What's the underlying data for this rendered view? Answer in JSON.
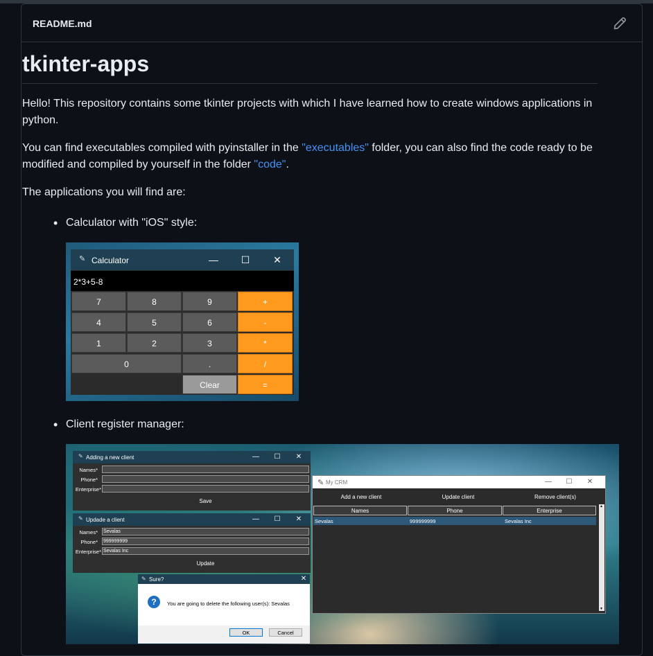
{
  "file": {
    "title": "README.md"
  },
  "readme": {
    "heading": "tkinter-apps",
    "intro": "Hello! This repository contains some tkinter projects with which I have learned how to create windows applications in python.",
    "para2": {
      "text1": "You can find executables compiled with pyinstaller in the ",
      "link1": "\"executables\"",
      "text2": " folder, you can also find the code ready to be modified and compiled by yourself in the folder ",
      "link2": "\"code\"",
      "text3": "."
    },
    "para3": "The applications you will find are:",
    "bullets": [
      "Calculator with \"iOS\" style:",
      "Client register manager:"
    ]
  },
  "calculator": {
    "title": "Calculator",
    "display": "2*3+5-8",
    "controls": {
      "minimize": "—",
      "maximize": "☐",
      "close": "✕"
    },
    "keys": [
      "7",
      "8",
      "9",
      "+",
      "4",
      "5",
      "6",
      "-",
      "1",
      "2",
      "3",
      "*",
      "0",
      ".",
      "/",
      "Clear",
      "="
    ]
  },
  "crm": {
    "add_window": {
      "title": "Adding a new client",
      "labels": [
        "Names*",
        "Phone*",
        "Enterprise*"
      ],
      "values": [
        "",
        "",
        ""
      ],
      "button": "Save"
    },
    "update_window": {
      "title": "Updade a client",
      "labels": [
        "Names*",
        "Phone*",
        "Enterprise*"
      ],
      "values": [
        "Sevalas",
        "999999999",
        "Sevalas Inc"
      ],
      "button": "Update"
    },
    "main_window": {
      "title": "My CRM",
      "actions": [
        "Add a new client",
        "Update client",
        "Remove client(s)"
      ],
      "columns": [
        "Names",
        "Phone",
        "Enterprise"
      ],
      "rows": [
        [
          "Sevalas",
          "999999999",
          "Sevalas Inc"
        ]
      ]
    },
    "dialog": {
      "title": "Sure?",
      "message": "You are going to delete the following user(s): Sevalas",
      "ok": "OK",
      "cancel": "Cancel"
    },
    "controls": {
      "minimize": "—",
      "maximize": "☐",
      "close": "✕"
    }
  },
  "colors": {
    "link": "#4493f8",
    "operator_key": "#ff9a1f",
    "number_key": "#5b5b5b"
  },
  "icons": {
    "edit": "pencil-icon",
    "tk": "feather-icon",
    "question": "question-icon"
  }
}
